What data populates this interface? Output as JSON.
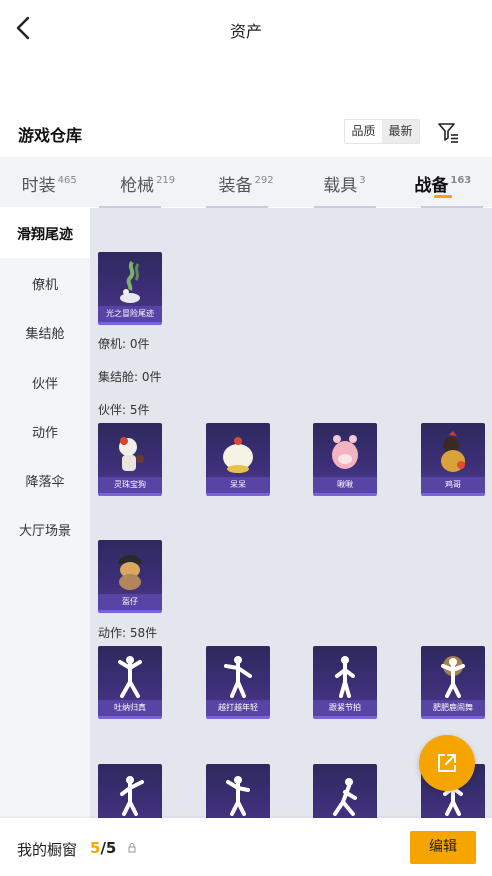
{
  "header": {
    "title": "资产"
  },
  "warehouse": {
    "title": "游戏仓库",
    "sort_options": [
      "品质",
      "最新"
    ]
  },
  "tabs": [
    {
      "label": "时装",
      "count": "465"
    },
    {
      "label": "枪械",
      "count": "219"
    },
    {
      "label": "装备",
      "count": "292"
    },
    {
      "label": "载具",
      "count": "3"
    },
    {
      "label": "战备",
      "count": "163"
    }
  ],
  "sidebar": {
    "header": "滑翔尾迹",
    "items": [
      "僚机",
      "集结舱",
      "伙伴",
      "动作",
      "降落伞",
      "大厅场景"
    ]
  },
  "sections": {
    "trail_card": "光之冒险尾迹",
    "wingman": "僚机: 0件",
    "capsule": "集结舱: 0件",
    "partners": "伙伴: 5件",
    "partner_cards": [
      "灵珠宝狗",
      "呆呆",
      "啾啾",
      "鸡哥",
      "盔仔"
    ],
    "actions": "动作: 58件",
    "action_cards": [
      "吐纳归真",
      "越打越年轻",
      "跟紧节拍",
      "肥肥鹿闹舞"
    ]
  },
  "bottom": {
    "label": "我的橱窗",
    "count_current": "5",
    "count_sep": "/",
    "count_total": "5",
    "edit_label": "编辑"
  },
  "colors": {
    "accent": "#f5a400",
    "card_bg": "#2c2a5e"
  }
}
